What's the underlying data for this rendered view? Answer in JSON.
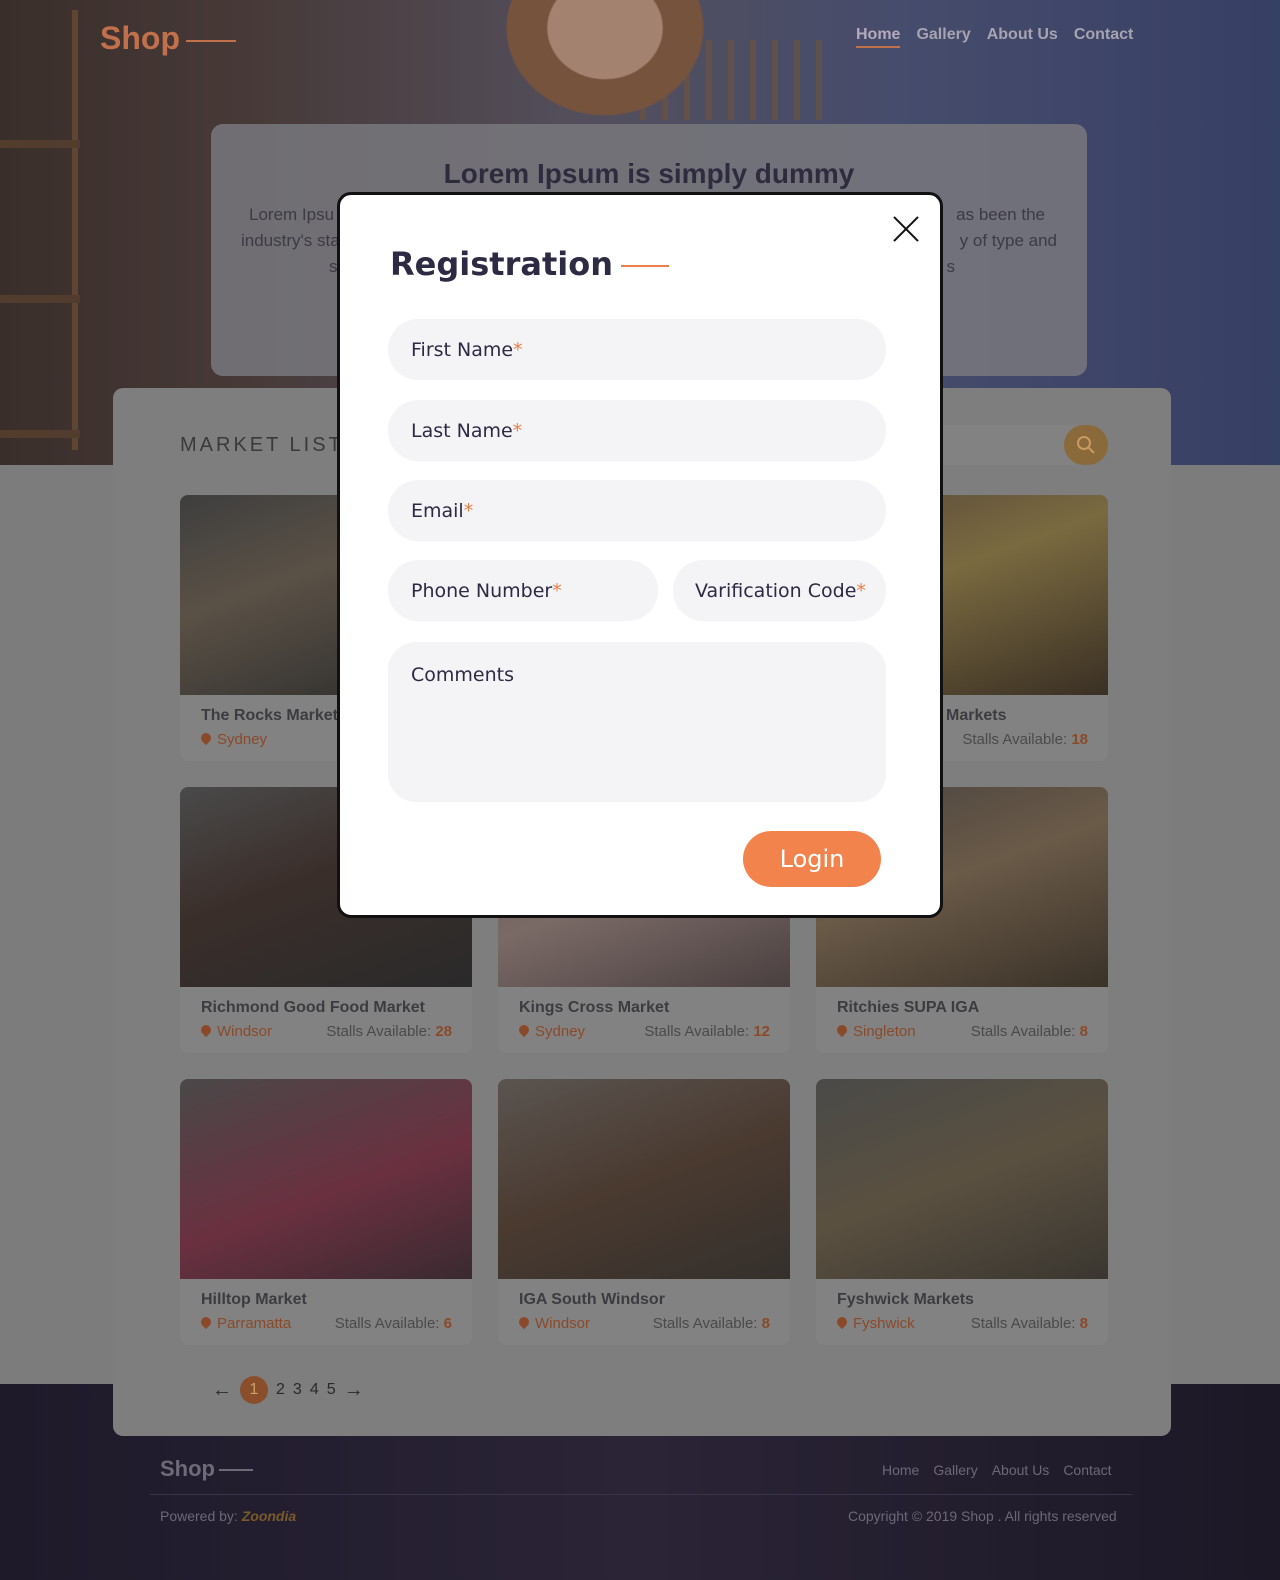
{
  "header": {
    "logo": "Shop",
    "nav": [
      "Home",
      "Gallery",
      "About Us",
      "Contact"
    ]
  },
  "hero": {
    "title": "Lorem Ipsum is simply dummy",
    "text_left_1": "Lorem Ipsu",
    "text_left_2": "industry's sta",
    "text_left_3": "s",
    "text_right_1": "as been the",
    "text_right_2": "y of type and",
    "text_right_3": "s"
  },
  "market": {
    "title": "MARKET LIST",
    "cards": [
      {
        "name": "The Rocks Market",
        "location": "Sydney",
        "stalls_label": "S",
        "stalls": ""
      },
      {
        "name": "",
        "location": "",
        "stalls_label": "",
        "stalls": ""
      },
      {
        "name": "Markets",
        "location": "",
        "stalls_label": "Stalls Available:",
        "stalls": "18"
      },
      {
        "name": "Richmond Good Food Market",
        "location": "Windsor",
        "stalls_label": "Stalls Available:",
        "stalls": "28"
      },
      {
        "name": "Kings Cross Market",
        "location": "Sydney",
        "stalls_label": "Stalls Available:",
        "stalls": "12"
      },
      {
        "name": "Ritchies SUPA IGA",
        "location": "Singleton",
        "stalls_label": "Stalls Available:",
        "stalls": "8"
      },
      {
        "name": "Hilltop Market",
        "location": "Parramatta",
        "stalls_label": "Stalls Available:",
        "stalls": "6"
      },
      {
        "name": "IGA South Windsor",
        "location": "Windsor",
        "stalls_label": "Stalls Available:",
        "stalls": "8"
      },
      {
        "name": "Fyshwick Markets",
        "location": "Fyshwick",
        "stalls_label": "Stalls Available:",
        "stalls": "8"
      }
    ],
    "pagination": {
      "prev": "←",
      "pages": [
        "1",
        "2",
        "3",
        "4",
        "5"
      ],
      "next": "→"
    }
  },
  "footer": {
    "logo": "Shop",
    "nav": [
      "Home",
      "Gallery",
      "About Us",
      "Contact"
    ],
    "powered_label": "Powered by:",
    "powered_brand": "Zoondia",
    "copyright": "Copyright © 2019 Shop . All rights reserved"
  },
  "modal": {
    "title": "Registration",
    "first_name": "First Name",
    "last_name": "Last Name",
    "email": "Email",
    "phone": "Phone Number",
    "code": "Varification Code",
    "comments": "Comments",
    "required_mark": "*",
    "login": "Login"
  },
  "colors": {
    "accent": "#f3834c",
    "heading": "#2d2a44",
    "field_bg": "#f4f4f6"
  }
}
